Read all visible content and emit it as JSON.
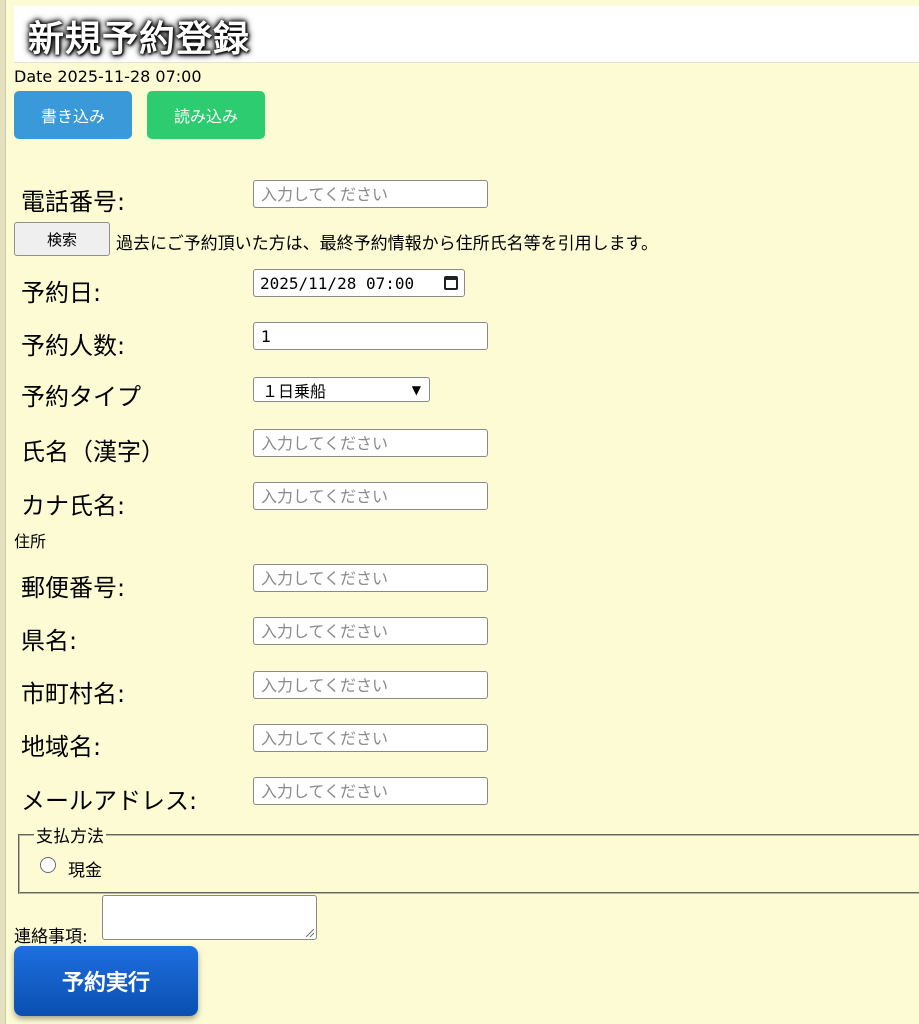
{
  "header": {
    "title": "新規予約登録",
    "date_text": "Date 2025-11-28 07:00"
  },
  "toolbar": {
    "write_label": "書き込み",
    "read_label": "読み込み"
  },
  "form": {
    "placeholder": "入力してください",
    "phone_label": "電話番号:",
    "search_button_label": "検索",
    "search_note": "過去にご予約頂いた方は、最終予約情報から住所氏名等を引用します。",
    "date_label": "予約日:",
    "date_value": "2025/11/28 07:00",
    "people_label": "予約人数:",
    "people_value": "1",
    "type_label": "予約タイプ",
    "type_selected": "１日乗船",
    "name_kanji_label": "氏名（漢字）",
    "name_kana_label": "カナ氏名:",
    "address_heading": "住所",
    "postal_label": "郵便番号:",
    "prefecture_label": "県名:",
    "city_label": "市町村名:",
    "area_label": "地域名:",
    "email_label": "メールアドレス:",
    "payment_legend": "支払方法",
    "payment_option_cash": "現金",
    "note_label": "連絡事項:",
    "submit_label": "予約実行"
  },
  "colors": {
    "background": "#fdfbd3",
    "write_button": "#3a9ad9",
    "read_button": "#2ecc71",
    "submit_button": "#0a4fb0"
  }
}
